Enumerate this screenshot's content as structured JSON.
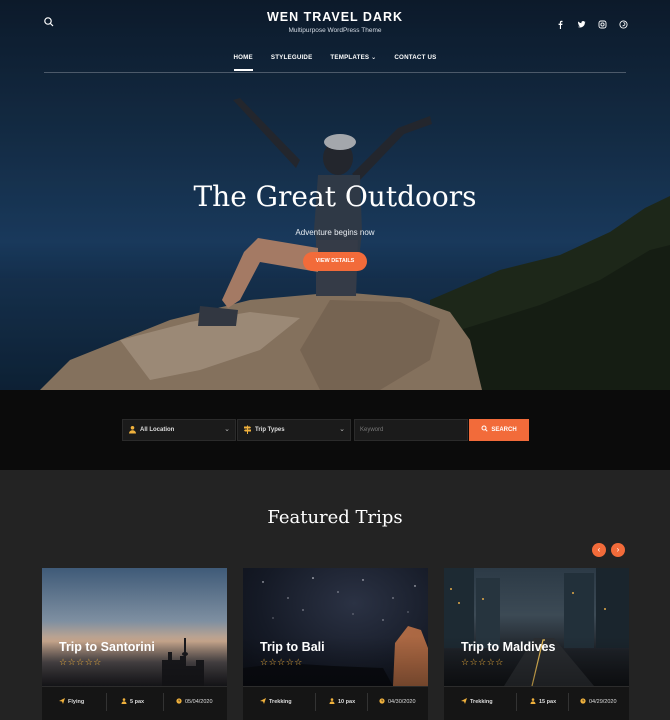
{
  "header": {
    "site_title": "WEN TRAVEL DARK",
    "tagline": "Multipurpose WordPress Theme",
    "search_icon": "search-icon",
    "social": [
      "facebook-icon",
      "twitter-icon",
      "instagram-icon",
      "pinterest-icon"
    ]
  },
  "nav": {
    "items": [
      {
        "label": "HOME",
        "active": true
      },
      {
        "label": "STYLEGUIDE"
      },
      {
        "label": "TEMPLATES",
        "has_dropdown": true
      },
      {
        "label": "CONTACT US"
      }
    ]
  },
  "hero": {
    "title": "The Great Outdoors",
    "subtitle": "Adventure begins now",
    "button": "VIEW DETAILS"
  },
  "search": {
    "location": "All Location",
    "trip_types": "Trip Types",
    "keyword_placeholder": "Keyword",
    "button": "SEARCH"
  },
  "featured": {
    "title": "Featured Trips",
    "prev_icon": "chevron-left-icon",
    "next_icon": "chevron-right-icon",
    "trips": [
      {
        "name": "Trip to Santorini",
        "stars": "☆☆☆☆☆",
        "type": "Flying",
        "pax": "5 pax",
        "date": "05/04/2020"
      },
      {
        "name": "Trip to Bali",
        "stars": "☆☆☆☆☆",
        "type": "Trekking",
        "pax": "10 pax",
        "date": "04/30/2020"
      },
      {
        "name": "Trip to Maldives",
        "stars": "☆☆☆☆☆",
        "type": "Trekking",
        "pax": "15 pax",
        "date": "04/29/2020"
      }
    ]
  },
  "colors": {
    "accent": "#f26b3a",
    "background": "#232323",
    "star": "#f0b13c"
  }
}
